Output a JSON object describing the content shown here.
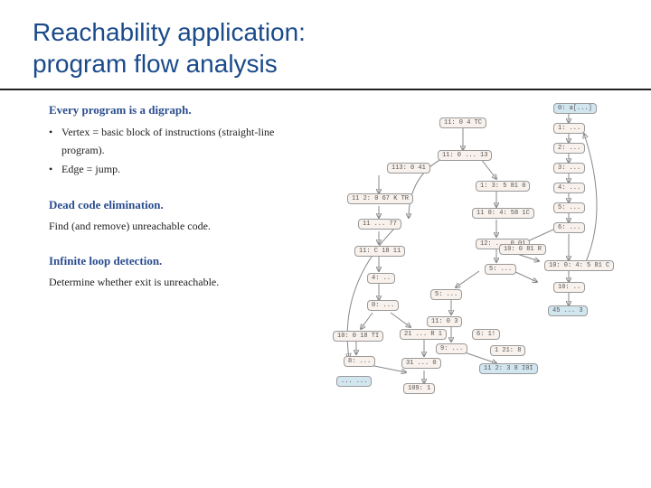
{
  "title": {
    "line1": "Reachability application:",
    "line2": "program flow analysis"
  },
  "section1": {
    "head": "Every program is a digraph.",
    "bullet1": "Vertex = basic block of instructions (straight-line program).",
    "bullet2": "Edge = jump."
  },
  "section2": {
    "head": "Dead code elimination.",
    "body": "Find (and remove) unreachable code."
  },
  "section3": {
    "head": "Infinite loop detection.",
    "body": "Determine whether exit is unreachable."
  },
  "nodes": {
    "n0": "0: a[...]",
    "n1": "1: ...",
    "n2": "2: ...",
    "n3": "3: ...",
    "n4": "4: ...",
    "n5": "5: ...",
    "n6": "6: ...",
    "n7": "11: 0 4 TC",
    "n8": "11: 0 ... 13",
    "n9": "113: 0 41",
    "n10": "11 2: 0 67 K TR",
    "n11": "11 ... 77",
    "n12": "11: C 18 11",
    "n13": "4: ..",
    "n14": "0: ...",
    "n15": "10: 0 18 TI",
    "n16": "8: ...",
    "n17": "... ...",
    "n18": "1: 3: 5 81 0",
    "n19": "11 0: 4: 58 1C",
    "n20": "12: ... 0 01",
    "n21": "5: ...",
    "n22": "11 2: 3 8 I0I",
    "n23": "10: 0 81 R",
    "n24": "5: ...",
    "n25": "21 ... R 1",
    "n26": "31 ... 0",
    "n27": "11: 0 3",
    "n28": "9: ...",
    "n29": "6: 1!",
    "n30": "1 21: 8",
    "n31": "10: 0: 4: 5 81 C",
    "n32": "10: ..",
    "n33": "45 ... 3",
    "n34": "109: 1"
  }
}
